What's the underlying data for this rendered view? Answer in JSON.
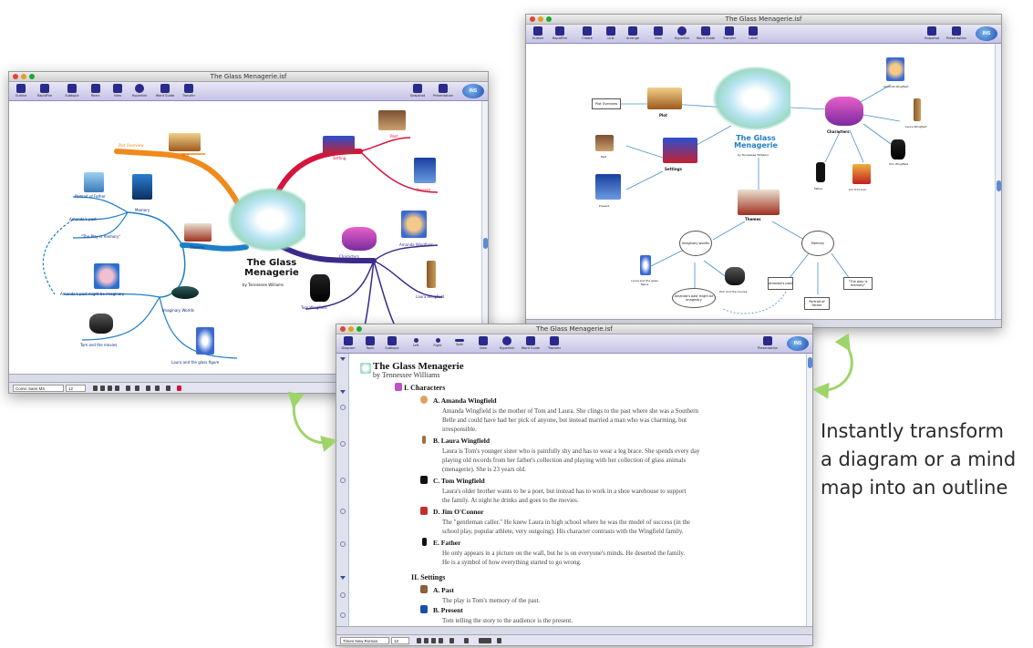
{
  "tagline": {
    "line1": "Instantly transform",
    "line2": "a diagram or a mind",
    "line3": "map into an outline"
  },
  "mindmap_window": {
    "title": "The Glass Menagerie.isf",
    "toolbar": [
      "Outline",
      "RapidFire",
      "Subtopic",
      "Rearr.",
      "Idea",
      "Hyperlink",
      "Word Guide",
      "Transfer"
    ],
    "toolbar_right": [
      "Snapshot",
      "Presentation"
    ],
    "map_title": "The Glass Menagerie",
    "map_subtitle": "by Tennessee Williams",
    "nodes": {
      "plot_overview": "Plot Overview",
      "plot": "Plot",
      "setting": "Setting",
      "past": "Past",
      "present": "Present",
      "portrait": "Portrait of Father",
      "amanda_past": "Amanda's past",
      "memory": "Memory",
      "play_is_memory": "\"The Play is memory\"",
      "themes": "Themes",
      "characters": "Characters",
      "amanda_wingfield": "Amanda Wingfield",
      "laura_wingfield": "Laura Wingfield",
      "tom_wingfield": "Tom Wingfield",
      "amanda_imagine": "Amanda's past might be imaginary",
      "imaginary_worlds": "Imaginary Worlds",
      "tom_movies": "Tom and the movies",
      "laura_glass": "Laura and the glass figure"
    },
    "font_name": "Comic Sans MS",
    "font_size": "12",
    "colors": {
      "plot": "#f08a1c",
      "setting": "#d4143c",
      "themes": "#1e7ec8",
      "characters": "#3c2a8a"
    }
  },
  "diagram_window": {
    "title": "The Glass Menagerie.isf",
    "toolbar": [
      "Outline",
      "RapidFire",
      "Create",
      "Link",
      "Arrange",
      "Idea",
      "Hyperlink",
      "Word Guide",
      "Transfer",
      "Label"
    ],
    "toolbar_right": [
      "Snapshot",
      "Presentation"
    ],
    "map_title": "The Glass Menagerie",
    "map_subtitle": "by Tennessee Williams",
    "nodes": {
      "plot_overview": "Plot Overview",
      "plot": "Plot",
      "past": "Past",
      "present": "Present",
      "settings": "Settings",
      "characters": "Characters",
      "amanda": "Amanda Wingfield",
      "laura": "Laura Wingfield",
      "tom": "Tom Wingfield",
      "father": "Father",
      "jim": "Jim O'Connor",
      "themes": "Themes",
      "imaginary": "Imaginary worlds",
      "memory": "Memory",
      "laura_glass": "Laura and the glass figure",
      "amanda_imagine": "Amanda's past might be imaginary",
      "tom_movies": "Tom and the movies",
      "amanda_past": "Amanda's past",
      "portrait": "Portrait of Father",
      "play_memory": "\"The play is memory\""
    }
  },
  "outline_window": {
    "title": "The Glass Menagerie.isf",
    "toolbar": [
      "Diagram",
      "Topic",
      "Subtopic",
      "Left",
      "Right",
      "Split",
      "Idea",
      "Hyperlink",
      "Word Guide",
      "Transfer"
    ],
    "toolbar_right": [
      "Presentation"
    ],
    "doc_title": "The Glass Menagerie",
    "doc_subtitle": "by Tennessee Williams",
    "sections": [
      {
        "heading": "I.  Characters",
        "items": [
          {
            "heading": "A.  Amanda Wingfield",
            "lines": [
              "Amanda Wingfield is the mother of Tom and Laura. She clings to the past where she was a Southern",
              "Belle and could have had her pick of anyone, but instead married a man who was charming, but",
              "irresponsible."
            ]
          },
          {
            "heading": "B.  Laura Wingfield",
            "lines": [
              "Laura is Tom's younger sister who is painfully shy and has to wear a leg brace. She spends every day",
              "playing old records from her father's collection and playing with her collection of glass animals",
              "(menagerie). She is 23 years old."
            ]
          },
          {
            "heading": "C.  Tom Wingfield",
            "lines": [
              "Laura's older brother wants to be a poet, but instead has to work in a shoe warehouse to support",
              "the family. At night he drinks and goes to the movies."
            ]
          },
          {
            "heading": "D.  Jim O'Connor",
            "lines": [
              "The \"gentleman caller.\" He knew Laura in high school where he was the model of success (in the",
              "school play, popular athlete, very outgoing). His character contrasts with the Wingfield family."
            ]
          },
          {
            "heading": "E.  Father",
            "lines": [
              "He only appears in a picture on the wall, but he is on everyone's minds. He deserted the family.",
              "He is a symbol of how everything started to go wrong."
            ]
          }
        ]
      },
      {
        "heading": "II.  Settings",
        "items": [
          {
            "heading": "A.  Past",
            "lines": [
              "The play is Tom's memory of the past."
            ]
          },
          {
            "heading": "B.  Present",
            "lines": [
              "Tom telling the story to the audience is the present."
            ]
          }
        ]
      }
    ],
    "font_name": "Times New Roman",
    "font_size": "12"
  }
}
